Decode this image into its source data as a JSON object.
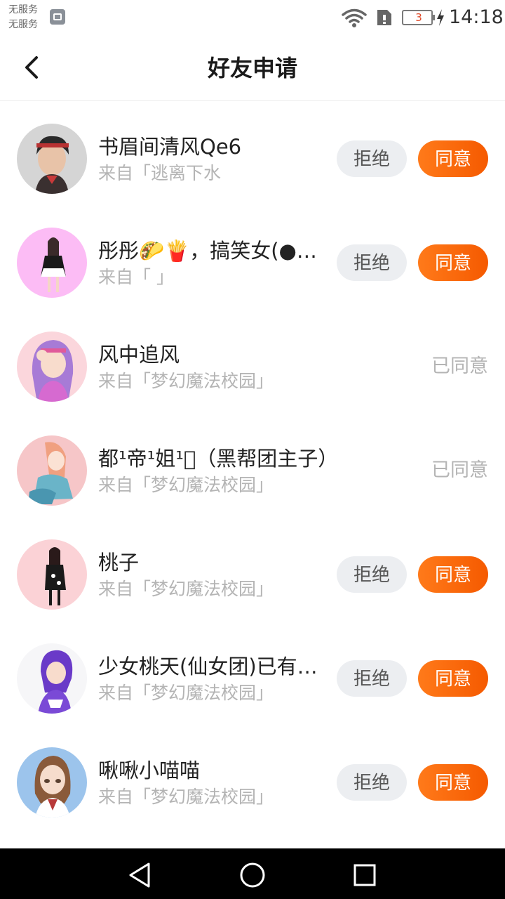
{
  "status_bar": {
    "carrier_line1": "无服务",
    "carrier_line2": "无服务",
    "battery_level": "3",
    "time": "14:18",
    "icons": [
      "image-icon",
      "wifi-icon",
      "sim-icon",
      "battery-icon",
      "charging-bolt-icon"
    ]
  },
  "header": {
    "title": "好友申请",
    "back_icon": "chevron-left-icon"
  },
  "buttons": {
    "reject": "拒绝",
    "accept": "同意",
    "accepted": "已同意"
  },
  "colors": {
    "accent": "#f96a0f",
    "reject_bg": "#eceef1",
    "secondary_text": "#b4b4b4"
  },
  "requests": [
    {
      "name": "书眉间清风Qe6",
      "source": "来自「逃离下水",
      "status": "pending"
    },
    {
      "name": "彤彤🌮🍟，搞笑女(●°…",
      "source": "来自「 」",
      "status": "pending"
    },
    {
      "name": "风中追风",
      "source": "来自「梦幻魔法校园」",
      "status": "accepted"
    },
    {
      "name": "都¹帝¹姐¹⃣（黑帮团主子）",
      "source": "来自「梦幻魔法校园」",
      "status": "accepted"
    },
    {
      "name": "桃子",
      "source": "来自「梦幻魔法校园」",
      "status": "pending"
    },
    {
      "name": "少女桃天(仙女团)已有…",
      "source": "来自「梦幻魔法校园」",
      "status": "pending"
    },
    {
      "name": "啾啾小喵喵",
      "source": "来自「梦幻魔法校园」",
      "status": "pending"
    }
  ],
  "nav_bar": {
    "icons": [
      "nav-back-icon",
      "nav-home-icon",
      "nav-recent-icon"
    ]
  }
}
